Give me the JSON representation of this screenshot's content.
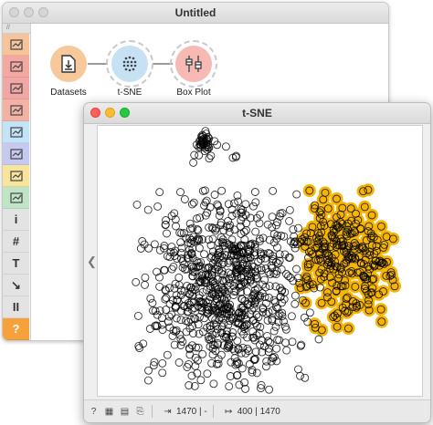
{
  "back_window": {
    "title": "Untitled",
    "toolbox": [
      {
        "icon": "data-icon",
        "bg": "#f6c39a"
      },
      {
        "icon": "transform-icon",
        "bg": "#f5a8a0"
      },
      {
        "icon": "visualize-icon",
        "bg": "#f2a6a6"
      },
      {
        "icon": "model-icon",
        "bg": "#f4b2a4"
      },
      {
        "icon": "evaluate-icon",
        "bg": "#c3e3f7"
      },
      {
        "icon": "unsupervised-icon",
        "bg": "#c6c9f0"
      },
      {
        "icon": "image-icon",
        "bg": "#f8e49a"
      },
      {
        "icon": "geo-icon",
        "bg": "#bfe5c6"
      },
      {
        "icon": "info-icon",
        "bg": "#e3e3e3",
        "glyph": "i"
      },
      {
        "icon": "hash-icon",
        "bg": "#e3e3e3",
        "glyph": "#"
      },
      {
        "icon": "text-icon",
        "bg": "#e3e3e3",
        "glyph": "T"
      },
      {
        "icon": "arrow-icon",
        "bg": "#e3e3e3",
        "glyph": "↘"
      },
      {
        "icon": "pause-icon",
        "bg": "#e3e3e3",
        "glyph": "II"
      },
      {
        "icon": "help-icon",
        "bg": "#f6a13c",
        "glyph": "?"
      }
    ],
    "widgets": [
      {
        "label": "Datasets",
        "color": "#f6c89a"
      },
      {
        "label": "t-SNE",
        "color": "#c6e0f4"
      },
      {
        "label": "Box Plot",
        "color": "#f6b9b4"
      }
    ]
  },
  "tsne_window": {
    "title": "t-SNE",
    "status": {
      "input_text": "1470 | -",
      "output_text": "400 | 1470"
    },
    "selection_color": "#f5b400",
    "point_color": "#000000"
  }
}
